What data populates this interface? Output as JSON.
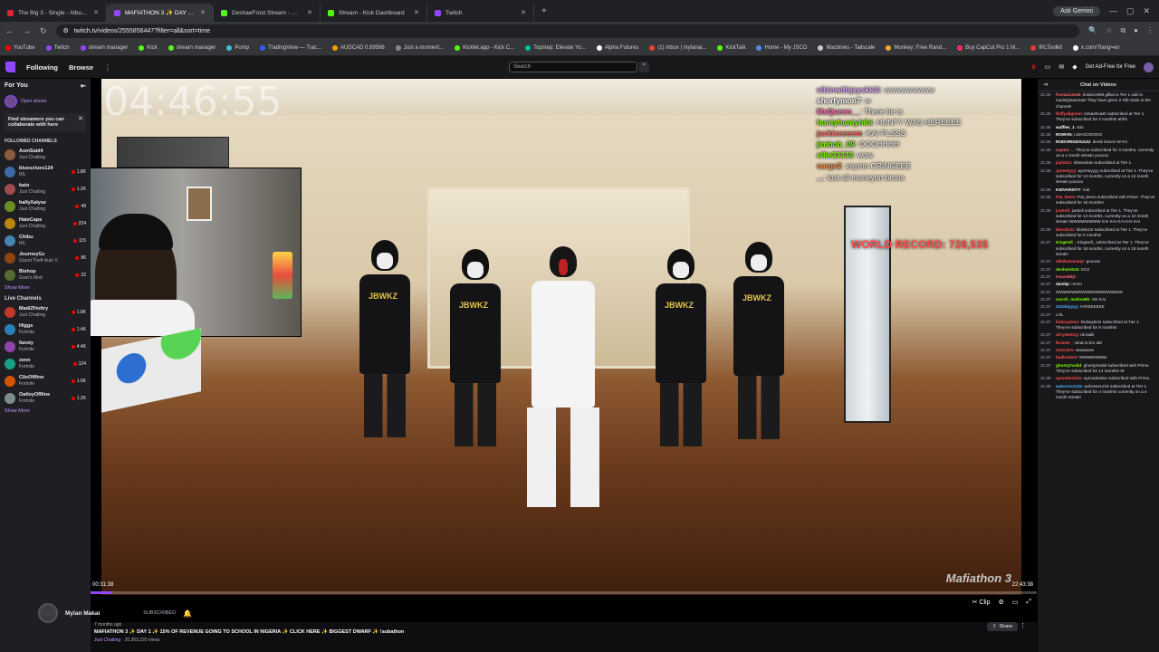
{
  "browser": {
    "tabs": [
      {
        "label": "The Big 3 - Single - Album by R...",
        "color": "#e22134",
        "active": false
      },
      {
        "label": "MAFIATHON 3 ✨ DAY 1 ✨...",
        "color": "#9147ff",
        "active": true
      },
      {
        "label": "DeshaeFrost Stream - Watch Li...",
        "color": "#53fc18",
        "active": false
      },
      {
        "label": "Stream - Kick Dashboard",
        "color": "#53fc18",
        "active": false
      },
      {
        "label": "Twitch",
        "color": "#9147ff",
        "active": false
      }
    ],
    "ask_gemini": "Ask Gemini",
    "url": "twitch.tv/videos/2555856447?filter=all&sort=time",
    "bookmarks": [
      {
        "label": "YouTube",
        "color": "#ff0000"
      },
      {
        "label": "Twitch",
        "color": "#9147ff"
      },
      {
        "label": "stream manager",
        "color": "#9147ff"
      },
      {
        "label": "Kick",
        "color": "#53fc18"
      },
      {
        "label": "stream manager",
        "color": "#53fc18"
      },
      {
        "label": "Pump",
        "color": "#36c2d8"
      },
      {
        "label": "TradingView — Trac...",
        "color": "#2962ff"
      },
      {
        "label": "AUDCAD 0.89596",
        "color": "#ff9800"
      },
      {
        "label": "Just a moment...",
        "color": "#888888"
      },
      {
        "label": "Kicklet.app - Kick C...",
        "color": "#53fc18"
      },
      {
        "label": "Topstep: Elevate Yo...",
        "color": "#00bfa5"
      },
      {
        "label": "Alpha Futures",
        "color": "#ffffff"
      },
      {
        "label": "(1) Inbox | mylanai...",
        "color": "#ea4335"
      },
      {
        "label": "KickTalk",
        "color": "#53fc18"
      },
      {
        "label": "Home - My JSCO",
        "color": "#4a90e2"
      },
      {
        "label": "Machines - Tailscale",
        "color": "#cccccc"
      },
      {
        "label": "Monkey: Free Rand...",
        "color": "#f5a623"
      },
      {
        "label": "Buy CapCut Pro 1 M...",
        "color": "#ff2d55"
      },
      {
        "label": "IRLToolkit",
        "color": "#e53935"
      },
      {
        "label": "x.com/?lang=en",
        "color": "#ffffff"
      }
    ]
  },
  "twitch_nav": {
    "following": "Following",
    "browse": "Browse",
    "search_placeholder": "Search",
    "ad_free": "Get Ad-Free for Free"
  },
  "sidebar": {
    "for_you": "For You",
    "open_stories": "Open stories",
    "card_text": "Find streamers you can collaborate with here",
    "followed_header": "FOLLOWED CHANNELS",
    "followed": [
      {
        "name": "AsmSaid4",
        "game": "Just Chatting",
        "viewers": "",
        "color": "#8a5b3c"
      },
      {
        "name": "bluesclues124",
        "game": "IRL",
        "viewers": "1.8K",
        "color": "#3a6aa8"
      },
      {
        "name": "kato",
        "game": "Just Chatting",
        "viewers": "1.2K",
        "color": "#a04c4c"
      },
      {
        "name": "hallyXalyse",
        "game": "Just Chatting",
        "viewers": "49",
        "color": "#6b8e23"
      },
      {
        "name": "HateCaps",
        "game": "Just Chatting",
        "viewers": "224",
        "color": "#b8860b"
      },
      {
        "name": "Chibu",
        "game": "IRL",
        "viewers": "115",
        "color": "#4682b4"
      },
      {
        "name": "JourneyGz",
        "game": "Grand Theft Auto V",
        "viewers": "86",
        "color": "#8b4513"
      },
      {
        "name": "Bishop",
        "game": "Gran's Mod",
        "viewers": "22",
        "color": "#556b2f"
      }
    ],
    "show_more_1": "Show More",
    "live_header": "Live Channels",
    "live": [
      {
        "name": "MadiZHottry",
        "game": "Just Chatting",
        "viewers": "1.8K",
        "color": "#c0392b"
      },
      {
        "name": "Higgs",
        "game": "Fortnite",
        "viewers": "1.4K",
        "color": "#2980b9"
      },
      {
        "name": "faxsty",
        "game": "Fortnite",
        "viewers": "4.4K",
        "color": "#8e44ad"
      },
      {
        "name": "zenn",
        "game": "Fortnite",
        "viewers": "124",
        "color": "#16a085"
      },
      {
        "name": "ClixOffline",
        "game": "Fortnite",
        "viewers": "1.6K",
        "color": "#d35400"
      },
      {
        "name": "OatleyOffline",
        "game": "Fortnite",
        "viewers": "1.2K",
        "color": "#7f8c8d"
      }
    ],
    "show_more_2": "Show More"
  },
  "video": {
    "timer": "04:46:55",
    "world_record": "WORLD RECORD: 728,535",
    "watermark": "Mafiathon 3",
    "current_time": "00:31:38",
    "end_time": "22:43:38",
    "progress": 0.023,
    "overlay_chat": [
      {
        "user": "vibinwithjayskkiii",
        "text": "wwwwwwwww",
        "color": "#e3a6ff"
      },
      {
        "user": "shortymon7",
        "text": "w",
        "color": "#ffffff"
      },
      {
        "user": "MsQueen__",
        "text": "There he is",
        "color": "#ff6fb1"
      },
      {
        "user": "huntyhuntyhihi",
        "text": "HUNTY WAS HEREEEE",
        "color": "#7cfc00"
      },
      {
        "user": "jackieeeeem",
        "text": "KAI PLSSS",
        "color": "#ff6b6b"
      },
      {
        "user": "jimbob_09",
        "text": "OOOHHHH",
        "color": "#7cfc00"
      },
      {
        "user": "ellie33333",
        "text": "wow",
        "color": "#7cfc00"
      },
      {
        "user": "sarge2",
        "text": "zaymn CRINGEEE",
        "color": "#ff8c42"
      },
      {
        "user": "...",
        "text": "lost all moneyon bronx",
        "color": "#ffffff"
      }
    ],
    "channel": {
      "name": "Mylan Makai",
      "subscribed": "SUBSCRIBED",
      "bell_icon": "bell-icon"
    },
    "title_line": "MAFIATHON 3 ✨ DAY 1 ✨ 15% OF REVENUE GOING TO SCHOOL IN NIGERIA ✨ CLICK HERE ✨ BIGGEST DWARF ✨ !subathon",
    "posted": "7 months ago",
    "category": "Just Chatting",
    "views": "20,363,220 views",
    "share": "Share"
  },
  "chat": {
    "header": "Chat on Videos",
    "messages": [
      {
        "ts": "31:35",
        "user": "frostar12345",
        "text": "kossie1998 gifted a Tier 1 sub to marielystaveras! They have given 2 Gift Subs in the channel!",
        "color": "#ff6b6b"
      },
      {
        "ts": "31:35",
        "user": "fluffyallgreen",
        "text": "imbashcash subscribed at Tier 1. They've subscribed for 2 months! ahhh",
        "color": "#ff4f4f"
      },
      {
        "ts": "31:35",
        "user": "waffles_1",
        "text": "sob",
        "color": "#ffffff"
      },
      {
        "ts": "31:35",
        "user": "ROWVN",
        "text": "LMAOOOOOO",
        "color": "#ffffff"
      },
      {
        "ts": "31:35",
        "user": "RODORIGESUUU",
        "text": "drusk Dance W KC",
        "color": "#ffffff"
      },
      {
        "ts": "31:35",
        "user": "zaymn",
        "text": "... They've subscribed for 3 months, currently on a 1 month streak! yooooo",
        "color": "#ff6b6b"
      },
      {
        "ts": "31:36",
        "user": "jaylulu1",
        "text": "shessokan subscribed at Tier 1.",
        "color": "#ff4f4f"
      },
      {
        "ts": "31:36",
        "user": "ayemeyyy",
        "text": "ayemeyyyy subscribed at Tier 1. They've subscribed for 14 months, currently on a 14 month streak! yooooo",
        "color": "#ff4f4f"
      },
      {
        "ts": "31:36",
        "user": "KIDVARSITY",
        "text": "sob",
        "color": "#ffffff"
      },
      {
        "ts": "31:36",
        "user": "Pat_leeeo",
        "text": "Pat_leeeo subscribed with Prime. They've subscribed for 15 months!",
        "color": "#ff4f4f"
      },
      {
        "ts": "31:36",
        "user": "justtoli",
        "text": "justtoli subscribed at Tier 1. They've subscribed for 14 months, currently on a 10 month streak! WWWWWWWW KAI KAI KAI KAI KAI",
        "color": "#ff4f4f"
      },
      {
        "ts": "31:36",
        "user": "kbosk13r",
        "text": "kbosk13r subscribed at Tier 1. They've subscribed for 5 months!",
        "color": "#ff4f4f"
      },
      {
        "ts": "31:37",
        "user": "KingKell_",
        "text": "KingKell_ subscribed at Tier 1. They've subscribed for 18 months, currently on a 18 month streak!",
        "color": "#7cfc00"
      },
      {
        "ts": "31:37",
        "user": "alleibutamanjr",
        "text": "gooooo",
        "color": "#ff4f4f"
      },
      {
        "ts": "31:37",
        "user": "deshamb34",
        "text": "KC3",
        "color": "#7cfc00"
      },
      {
        "ts": "31:37",
        "user": "KnuckiBjr",
        "text": "",
        "color": "#ff6b6b"
      },
      {
        "ts": "31:37",
        "user": "damkp",
        "text": "mmm",
        "color": "#ffffff"
      },
      {
        "ts": "31:37",
        "user": "",
        "text": "WWWWWWWWWWWWWWWWW",
        "color": "#ff4f4f"
      },
      {
        "ts": "31:37",
        "user": "marsh_mallow8b",
        "text": "OK KAI",
        "color": "#7cfc00"
      },
      {
        "ts": "31:37",
        "user": "222skiyyyy",
        "text": "AYEEEEEEE",
        "color": "#4fb4ff"
      },
      {
        "ts": "31:37",
        "user": "",
        "text": "LOL",
        "color": "#ff4f4f"
      },
      {
        "ts": "31:37",
        "user": "lindsaylens",
        "text": "lindsaylens subscribed at Tier 1. They've subscribed for 8 months!",
        "color": "#ff4f4f"
      },
      {
        "ts": "31:37",
        "user": "alrrydotorg",
        "text": "ok kaiiii",
        "color": "#ff4f4f"
      },
      {
        "ts": "31:37",
        "user": "lbckets_",
        "text": "what is bro abt",
        "color": "#ff4f4f"
      },
      {
        "ts": "31:37",
        "user": "missslev",
        "text": "wwwwww",
        "color": "#ff4f4f"
      },
      {
        "ts": "31:37",
        "user": "badhuder0",
        "text": "WWWWWWW",
        "color": "#ff4f4f"
      },
      {
        "ts": "31:37",
        "user": "ghosty2valid",
        "text": "ghosty2valid subscribed with Prime. They've subscribed for 14 months! W",
        "color": "#7cfc00"
      },
      {
        "ts": "31:38",
        "user": "aymodestion",
        "text": "aymodestion subscribed with Prime.",
        "color": "#ff4f4f"
      },
      {
        "ts": "31:38",
        "user": "aubosss1215",
        "text": "aubosss1215 subscribed at Tier 1. They've subscribed for 4 months! currently on a 4 month streak!",
        "color": "#4fb4ff"
      }
    ]
  }
}
